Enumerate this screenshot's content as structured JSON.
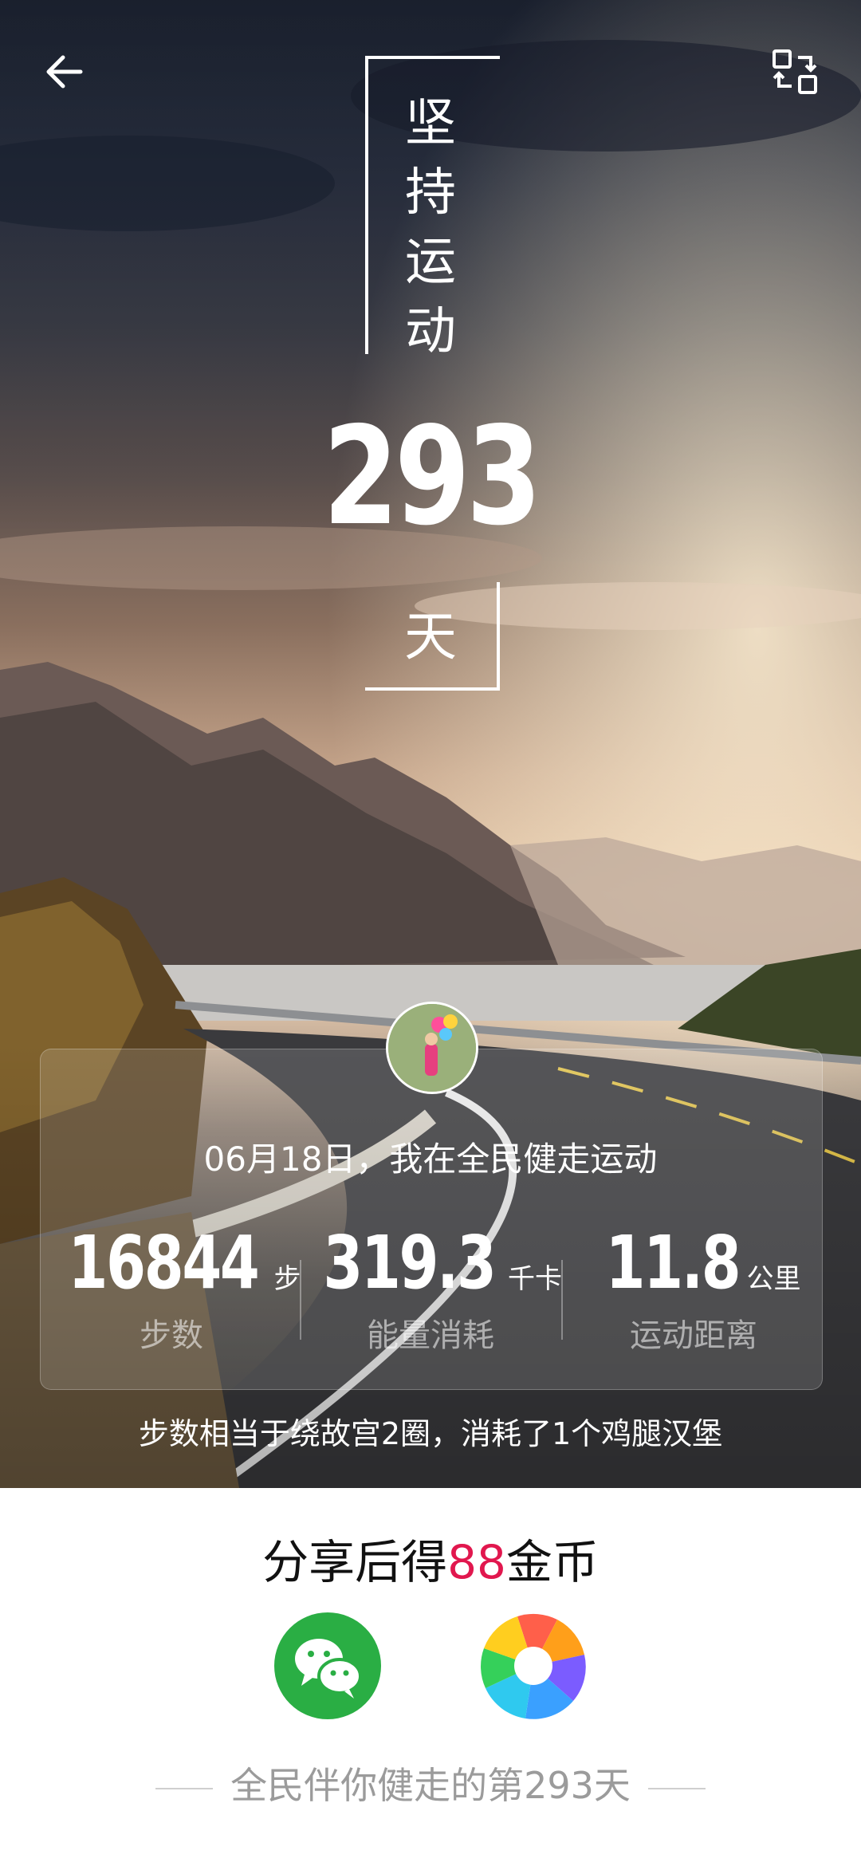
{
  "header": {
    "back_icon": "arrow-left-icon",
    "switch_icon": "switch-template-icon",
    "title_chars": [
      "坚",
      "持",
      "运",
      "动"
    ],
    "days_value": "293",
    "days_unit": "天"
  },
  "card": {
    "date_text": "06月18日，我在全民健走运动",
    "stats": [
      {
        "value": "16844",
        "unit": "步",
        "label": "步数"
      },
      {
        "value": "319.3",
        "unit": "千卡",
        "label": "能量消耗"
      },
      {
        "value": "11.8",
        "unit": "公里",
        "label": "运动距离"
      }
    ],
    "summary": "步数相当于绕故宫2圈，消耗了1个鸡腿汉堡"
  },
  "share": {
    "title_prefix": "分享后得",
    "coins": "88",
    "title_suffix": "金币",
    "accent_color": "#e1174e",
    "buttons": [
      {
        "icon": "wechat-icon",
        "color": "#2aae44"
      },
      {
        "icon": "moments-icon",
        "color": "#ffffff"
      }
    ]
  },
  "footer": {
    "text": "全民伴你健走的第293天"
  }
}
